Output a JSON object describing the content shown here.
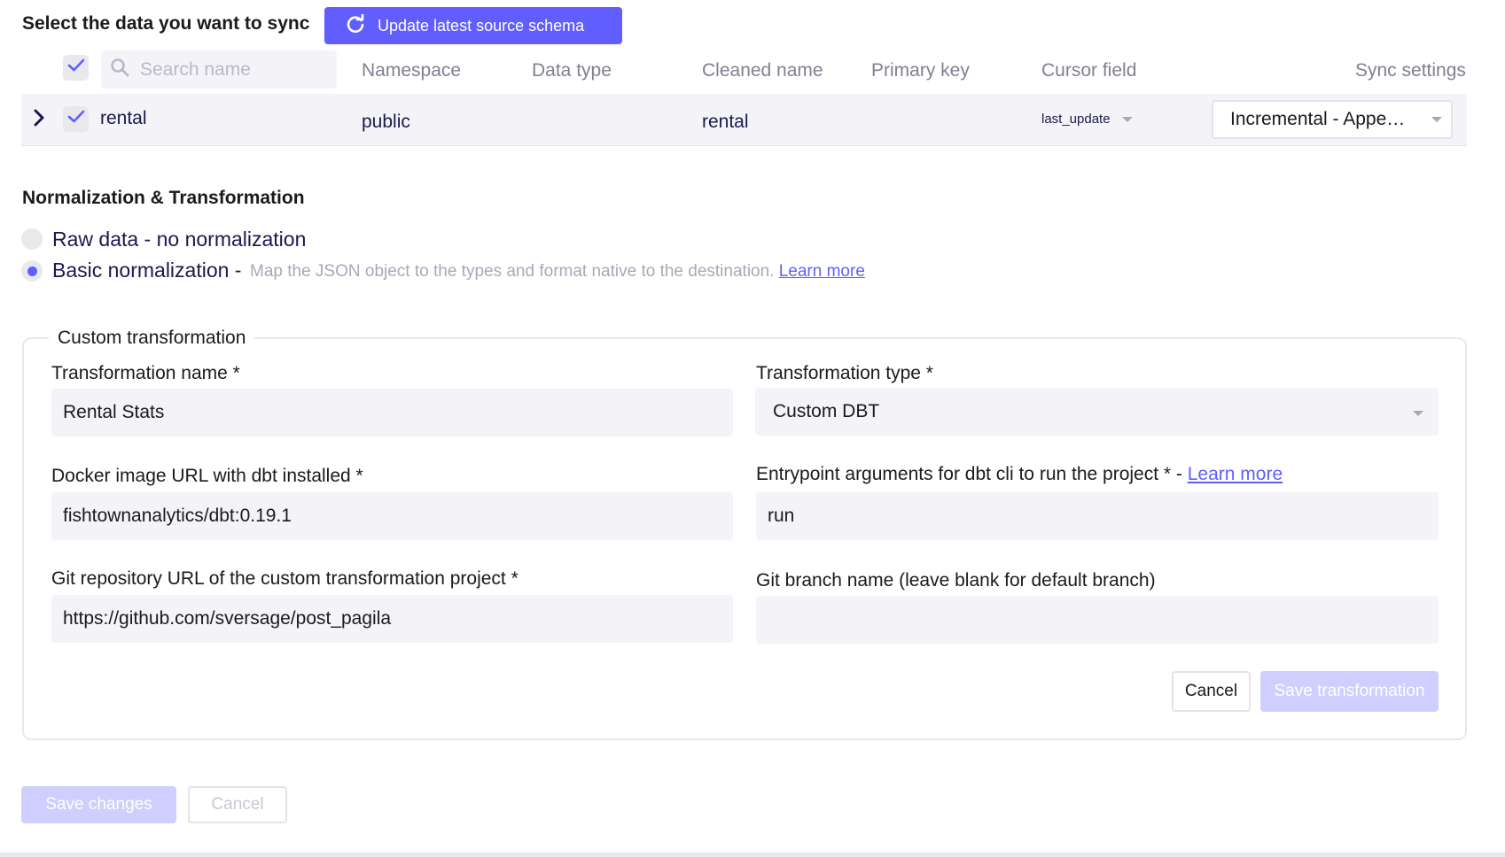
{
  "header": {
    "title": "Select the data you want to sync",
    "refresh_button": "Update latest source schema"
  },
  "table": {
    "search_placeholder": "Search name",
    "columns": [
      "Namespace",
      "Data type",
      "Cleaned name",
      "Primary key",
      "Cursor field",
      "Sync settings"
    ],
    "rows": [
      {
        "name": "rental",
        "checked": true,
        "namespace": "public",
        "data_type": "",
        "cleaned_name": "rental",
        "primary_key": "",
        "cursor_field": "last_update",
        "sync_mode": "Incremental - Appe…"
      }
    ]
  },
  "normalization": {
    "title": "Normalization & Transformation",
    "options": [
      {
        "label": "Raw data - no normalization",
        "selected": false
      },
      {
        "label": "Basic normalization -",
        "selected": true
      }
    ],
    "basic_description": "Map the JSON object to the types and format native to the destination.",
    "learn_more": "Learn more"
  },
  "custom_transformation": {
    "legend": "Custom transformation",
    "name_label": "Transformation name *",
    "name_value": "Rental Stats",
    "type_label": "Transformation type *",
    "type_value": "Custom DBT",
    "docker_label": "Docker image URL with dbt installed *",
    "docker_value": "fishtownanalytics/dbt:0.19.1",
    "entrypoint_label": "Entrypoint arguments for dbt cli to run the project * -",
    "entrypoint_learn_more": "Learn more",
    "entrypoint_value": "run",
    "git_url_label": "Git repository URL of the custom transformation project *",
    "git_url_value": "https://github.com/sversage/post_pagila",
    "git_branch_label": "Git branch name (leave blank for default branch)",
    "git_branch_value": "",
    "cancel_button": "Cancel",
    "save_button": "Save transformation"
  },
  "footer": {
    "save_changes": "Save changes",
    "cancel": "Cancel"
  },
  "colors": {
    "accent": "#615eff",
    "accent_disabled": "#cfcfff",
    "text_primary": "#1a194d",
    "text_muted": "#808090",
    "field_bg": "#f4f4f8"
  },
  "icons": {
    "refresh": "refresh-icon",
    "search": "search-icon",
    "check": "check-icon",
    "chevron": "chevron-right-icon",
    "dropdown": "caret-down-icon"
  }
}
